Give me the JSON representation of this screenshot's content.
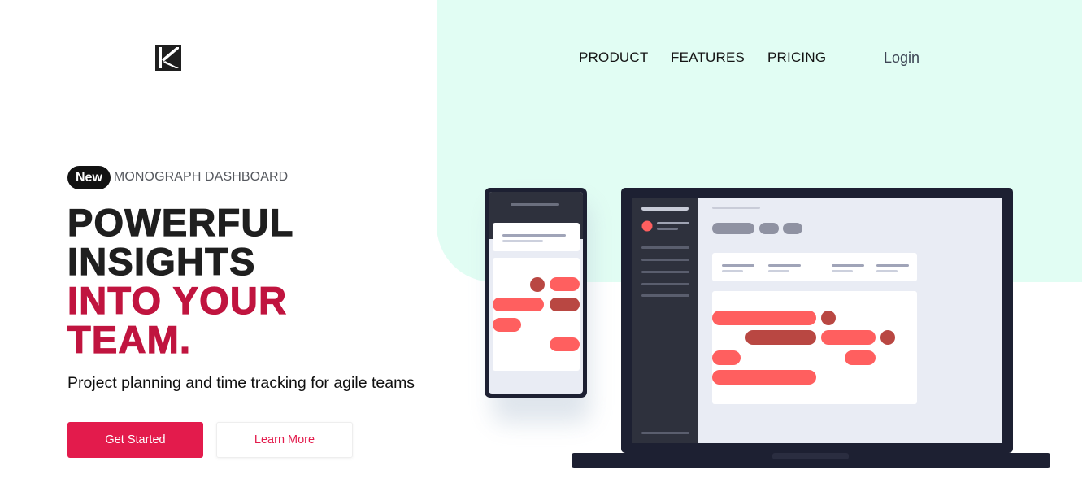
{
  "brand": {
    "logo_icon": "k-monogram-icon"
  },
  "nav": {
    "product": "PRODUCT",
    "features": "FEATURES",
    "pricing": "PRICING",
    "login": "Login"
  },
  "hero": {
    "badge": "New",
    "eyebrow": "MONOGRAPH DASHBOARD",
    "headline_dark": [
      "POWERFUL",
      "INSIGHTS"
    ],
    "headline_red": [
      "INTO YOUR",
      "TEAM."
    ],
    "subhead": "Project planning and time tracking for agile teams",
    "primary_cta": "Get Started",
    "secondary_cta": "Learn More"
  },
  "colors": {
    "accent": "#e31b4c",
    "headline_red": "#c0143f",
    "mint": "#e1fdf3",
    "device_dark": "#1d2032"
  }
}
